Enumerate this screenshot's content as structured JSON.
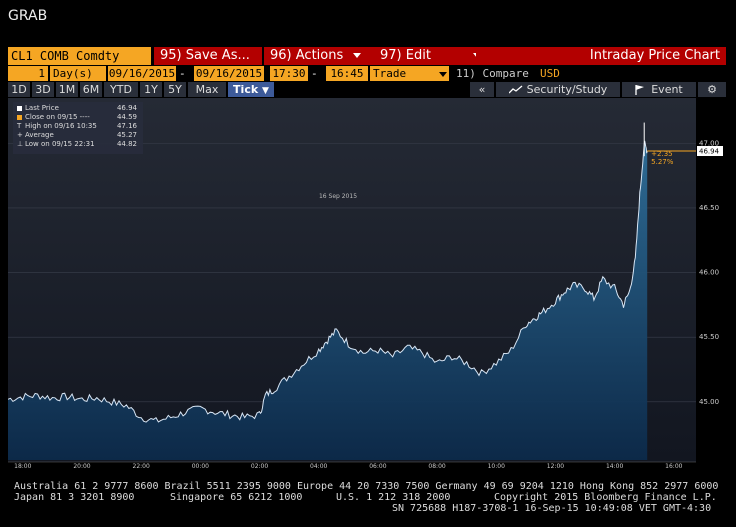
{
  "window_title": "GRAB",
  "toolbar": {
    "ticker": "CL1 COMB Comdty",
    "save_label": "Save As...",
    "save_code": "95)",
    "actions_label": "Actions",
    "actions_code": "96)",
    "edit_label": "Edit",
    "edit_code": "97)",
    "title": "Intraday Price Chart"
  },
  "controls": {
    "days_value": "1",
    "days_unit": "Day(s)",
    "start_date": "09/16/2015",
    "end_date": "09/16/2015",
    "start_time": "17:30",
    "end_time": "16:45",
    "field": "Trade",
    "compare_code": "11)",
    "compare_label": "Compare",
    "currency": "USD",
    "dash": "-"
  },
  "periods": [
    "1D",
    "3D",
    "1M",
    "6M",
    "YTD",
    "1Y",
    "5Y",
    "Max"
  ],
  "tick_label": "Tick",
  "right_buttons": {
    "collapse": "«",
    "security_study": "Security/Study",
    "event": "Event",
    "settings_icon": "gear-icon"
  },
  "legend": {
    "items": [
      {
        "label": "Last Price",
        "value": "46.94",
        "color": "#ffffff"
      },
      {
        "label": "Close on 09/15 ---- ",
        "value": "44.59",
        "color": "#f5a623"
      },
      {
        "label": "High on 09/16 10:35",
        "value": "47.16",
        "color": "#ffffff"
      },
      {
        "label": "Average",
        "value": "45.27",
        "color": "#ffffff"
      },
      {
        "label": "Low on 09/15 22:31",
        "value": "44.82",
        "color": "#ffffff"
      }
    ],
    "symbols": [
      "■",
      "■",
      "T",
      "+",
      "⊥"
    ]
  },
  "chart_data": {
    "type": "area",
    "date_label": "16 Sep 2015",
    "x_ticks": [
      "18:00",
      "20:00",
      "22:00",
      "00:00",
      "02:00",
      "04:00",
      "06:00",
      "08:00",
      "10:00",
      "12:00",
      "14:00",
      "16:00"
    ],
    "y_ticks": [
      "45.00",
      "45.50",
      "46.00",
      "46.50",
      "47.00"
    ],
    "y_tick_values": [
      45.0,
      45.5,
      46.0,
      46.5,
      47.0
    ],
    "ylim": [
      44.55,
      47.35
    ],
    "x_range_hours": [
      17.5,
      40.75
    ],
    "last_price_label": "46.94",
    "last_price": 46.94,
    "change_abs": "+2.35",
    "change_pct": "5.27%",
    "series": [
      {
        "points": [
          [
            17.5,
            45.02
          ],
          [
            18.0,
            45.04
          ],
          [
            18.5,
            45.05
          ],
          [
            19.0,
            45.03
          ],
          [
            19.5,
            45.04
          ],
          [
            20.0,
            45.02
          ],
          [
            20.5,
            45.03
          ],
          [
            21.0,
            45.0
          ],
          [
            21.5,
            44.97
          ],
          [
            22.0,
            44.88
          ],
          [
            22.5,
            44.85
          ],
          [
            23.0,
            44.88
          ],
          [
            23.5,
            44.92
          ],
          [
            24.0,
            44.95
          ],
          [
            24.5,
            44.92
          ],
          [
            25.0,
            44.9
          ],
          [
            25.5,
            44.88
          ],
          [
            26.0,
            44.9
          ],
          [
            26.2,
            45.05
          ],
          [
            26.5,
            45.1
          ],
          [
            27.0,
            45.2
          ],
          [
            27.5,
            45.3
          ],
          [
            28.0,
            45.4
          ],
          [
            28.3,
            45.48
          ],
          [
            28.6,
            45.55
          ],
          [
            29.0,
            45.45
          ],
          [
            29.5,
            45.38
          ],
          [
            30.0,
            45.4
          ],
          [
            30.5,
            45.35
          ],
          [
            31.0,
            45.42
          ],
          [
            31.5,
            45.38
          ],
          [
            32.0,
            45.3
          ],
          [
            32.5,
            45.35
          ],
          [
            33.0,
            45.3
          ],
          [
            33.5,
            45.22
          ],
          [
            34.0,
            45.3
          ],
          [
            34.5,
            45.4
          ],
          [
            35.0,
            45.6
          ],
          [
            35.3,
            45.65
          ],
          [
            35.6,
            45.7
          ],
          [
            36.0,
            45.78
          ],
          [
            36.3,
            45.85
          ],
          [
            36.6,
            45.9
          ],
          [
            37.0,
            45.88
          ],
          [
            37.3,
            45.8
          ],
          [
            37.6,
            45.95
          ],
          [
            38.0,
            45.88
          ],
          [
            38.3,
            45.75
          ],
          [
            38.5,
            45.85
          ],
          [
            38.7,
            46.1
          ],
          [
            38.85,
            46.6
          ],
          [
            39.0,
            47.0
          ],
          [
            39.1,
            46.94
          ]
        ]
      }
    ]
  },
  "footer": {
    "line1": "Australia 61 2 9777 8600 Brazil 5511 2395 9000 Europe 44 20 7330 7500 Germany 49 69 9204 1210 Hong Kong 852 2977 6000",
    "line2a": "Japan 81 3 3201 8900",
    "line2b": "Singapore 65 6212 1000",
    "line2c": "U.S. 1 212 318 2000",
    "line2d": "Copyright 2015 Bloomberg Finance L.P.",
    "line3": "SN 725688 H187-3708-1 16-Sep-15 10:49:08 VET  GMT-4:30"
  }
}
